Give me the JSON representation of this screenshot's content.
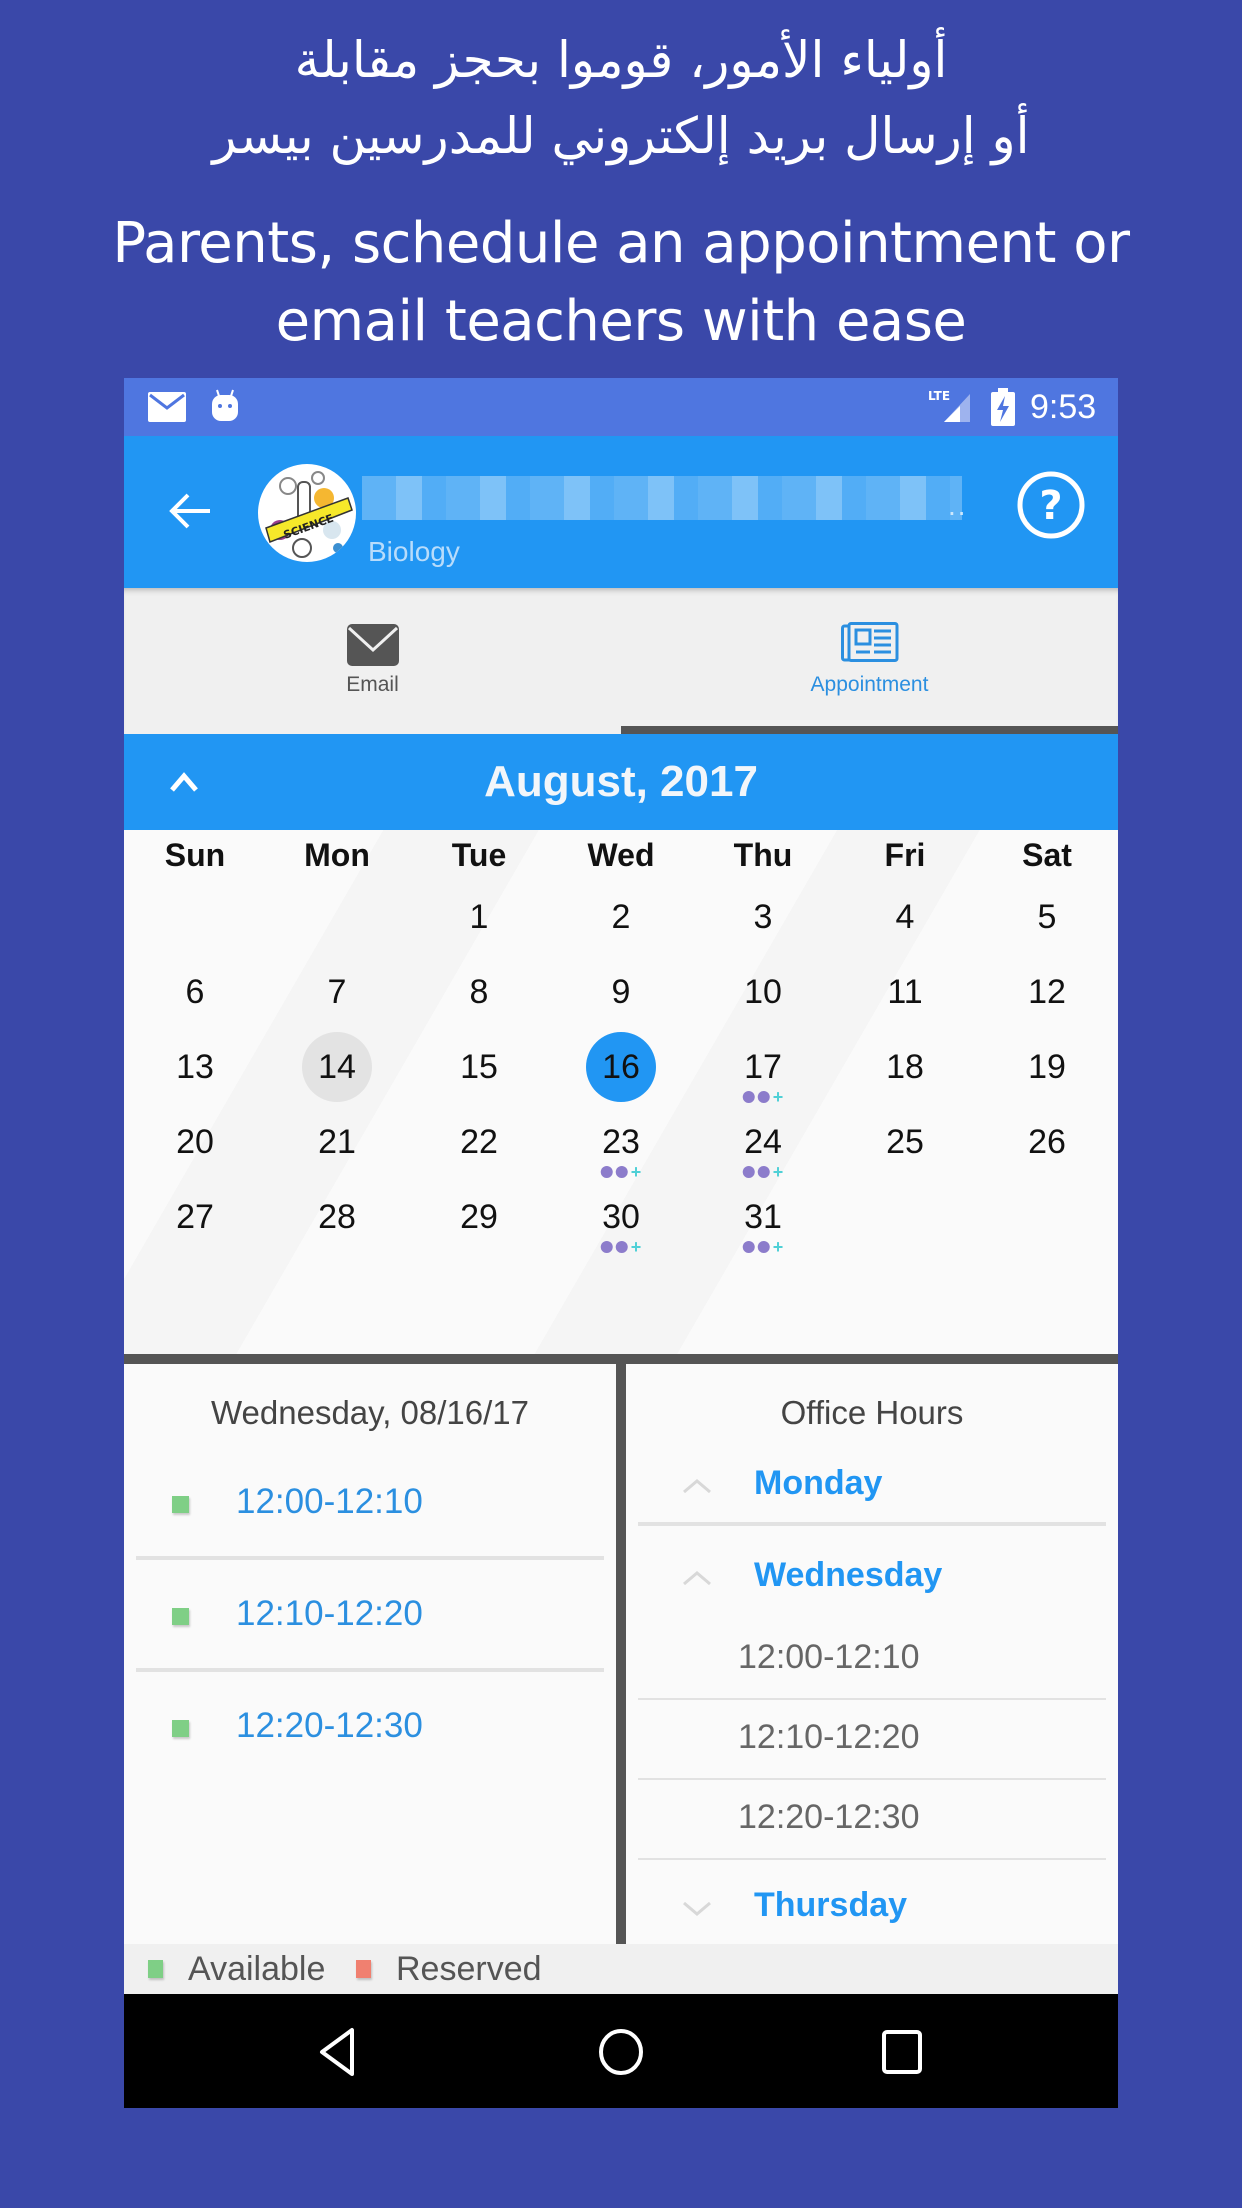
{
  "promo": {
    "arabic_line1": "أولياء الأمور، قوموا بحجز مقابلة",
    "arabic_line2": "أو إرسال بريد إلكتروني للمدرسين بيسر",
    "english_line1": "Parents, schedule an appointment or",
    "english_line2": "email teachers with ease"
  },
  "status_bar": {
    "icons": [
      "mail-icon",
      "android-icon",
      "lte-signal-icon",
      "battery-charging-icon"
    ],
    "network_label": "LTE",
    "time": "9:53"
  },
  "app_bar": {
    "back_icon": "arrow-left-icon",
    "teacher_name": "(name redacted)",
    "subject": "Biology",
    "avatar_label": "SCIENCE",
    "help_icon": "help-circle-icon"
  },
  "tabs": [
    {
      "label": "Email",
      "icon": "envelope-icon",
      "active": false
    },
    {
      "label": "Appointment",
      "icon": "newspaper-icon",
      "active": true
    }
  ],
  "calendar": {
    "month_title": "August, 2017",
    "collapse_icon": "chevron-up-icon",
    "weekdays": [
      "Sun",
      "Mon",
      "Tue",
      "Wed",
      "Thu",
      "Fri",
      "Sat"
    ],
    "weeks": [
      [
        "",
        "",
        "1",
        "2",
        "3",
        "4",
        "5"
      ],
      [
        "6",
        "7",
        "8",
        "9",
        "10",
        "11",
        "12"
      ],
      [
        "13",
        "14",
        "15",
        "16",
        "17",
        "18",
        "19"
      ],
      [
        "20",
        "21",
        "22",
        "23",
        "24",
        "25",
        "26"
      ],
      [
        "27",
        "28",
        "29",
        "30",
        "31",
        "",
        ""
      ]
    ],
    "today": "14",
    "selected": "16",
    "days_with_slots": [
      "17",
      "23",
      "24",
      "30",
      "31"
    ],
    "colors": {
      "selected": "#2196f3",
      "today": "#e3e3e3",
      "dot": "#8c7ccb",
      "plus": "#4fd0d6"
    }
  },
  "slots_panel": {
    "title": "Wednesday, 08/16/17",
    "slots": [
      {
        "time": "12:00-12:10",
        "status": "available"
      },
      {
        "time": "12:10-12:20",
        "status": "available"
      },
      {
        "time": "12:20-12:30",
        "status": "available"
      }
    ]
  },
  "office_hours": {
    "title": "Office Hours",
    "days": [
      {
        "name": "Monday",
        "expanded": false,
        "chevron": "chevron-up-icon",
        "slots": []
      },
      {
        "name": "Wednesday",
        "expanded": true,
        "chevron": "chevron-up-icon",
        "slots": [
          "12:00-12:10",
          "12:10-12:20",
          "12:20-12:30"
        ]
      },
      {
        "name": "Thursday",
        "expanded": false,
        "chevron": "chevron-down-icon",
        "slots": []
      }
    ]
  },
  "legend": {
    "items": [
      {
        "label": "Available",
        "color": "#7fcf86"
      },
      {
        "label": "Reserved",
        "color": "#f08070"
      }
    ]
  },
  "nav_bar": {
    "buttons": [
      "back-triangle-icon",
      "home-circle-icon",
      "recents-square-icon"
    ]
  },
  "colors": {
    "background": "#3a48a9",
    "status_bar": "#4f76e0",
    "primary": "#2196f3",
    "accent_text": "#2b8fe0",
    "divider": "#555555"
  }
}
